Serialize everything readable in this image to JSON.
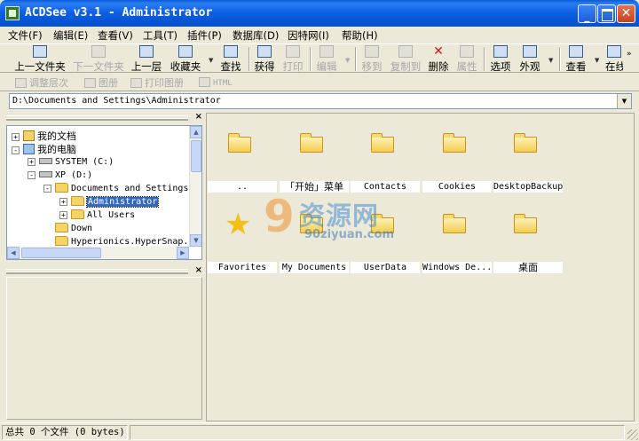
{
  "window": {
    "title": "ACDSee v3.1 - Administrator"
  },
  "menu": [
    "文件(F)",
    "编辑(E)",
    "查看(V)",
    "工具(T)",
    "插件(P)",
    "数据库(D)",
    "因特网(I)",
    "帮助(H)"
  ],
  "toolbar": {
    "items": [
      {
        "label": "上一文件夹",
        "icon": "folder-back-icon",
        "enabled": true,
        "dropdown": false
      },
      {
        "label": "下一文件夹",
        "icon": "folder-forward-icon",
        "enabled": false,
        "dropdown": false
      },
      {
        "label": "上一层",
        "icon": "folder-up-icon",
        "enabled": true,
        "dropdown": false
      },
      {
        "label": "收藏夹",
        "icon": "favorites-icon",
        "enabled": true,
        "dropdown": true
      },
      {
        "label": "查找",
        "icon": "binoculars-icon",
        "enabled": true,
        "dropdown": false
      },
      {
        "label": "获得",
        "icon": "acquire-icon",
        "enabled": true,
        "dropdown": false
      },
      {
        "label": "打印",
        "icon": "printer-icon",
        "enabled": false,
        "dropdown": false
      },
      {
        "label": "编辑",
        "icon": "edit-image-icon",
        "enabled": false,
        "dropdown": true
      },
      {
        "label": "移到",
        "icon": "move-to-icon",
        "enabled": false,
        "dropdown": false
      },
      {
        "label": "复制到",
        "icon": "copy-to-icon",
        "enabled": false,
        "dropdown": false
      },
      {
        "label": "删除",
        "icon": "delete-x-icon",
        "enabled": true,
        "dropdown": false
      },
      {
        "label": "属性",
        "icon": "properties-icon",
        "enabled": false,
        "dropdown": false
      },
      {
        "label": "选项",
        "icon": "options-tools-icon",
        "enabled": true,
        "dropdown": false
      },
      {
        "label": "外观",
        "icon": "layout-icon",
        "enabled": true,
        "dropdown": true
      },
      {
        "label": "查看",
        "icon": "view-list-icon",
        "enabled": true,
        "dropdown": true
      },
      {
        "label": "在线",
        "icon": "online-icon",
        "enabled": true,
        "dropdown": false
      }
    ]
  },
  "toolbar2": {
    "items": [
      {
        "label": "调整层次",
        "icon": "adjust-levels-icon"
      },
      {
        "label": "图册",
        "icon": "album-icon"
      },
      {
        "label": "打印图册",
        "icon": "print-album-icon"
      },
      {
        "label": "HTML",
        "icon": "html-icon"
      }
    ]
  },
  "address": {
    "path": "D:\\Documents and Settings\\Administrator"
  },
  "tree": {
    "nodes": [
      {
        "label": "我的文档",
        "icon": "my-documents-icon",
        "expander": "+",
        "mono": false,
        "selected": false
      },
      {
        "label": "我的电脑",
        "icon": "my-computer-icon",
        "expander": "-",
        "mono": false,
        "selected": false
      },
      {
        "label": "SYSTEM (C:)",
        "icon": "drive-icon",
        "expander": "+",
        "mono": true,
        "selected": false
      },
      {
        "label": "XP (D:)",
        "icon": "drive-icon",
        "expander": "-",
        "mono": true,
        "selected": false
      },
      {
        "label": "Documents and Settings",
        "icon": "folder-open-icon",
        "expander": "-",
        "mono": true,
        "selected": false
      },
      {
        "label": "Administrator",
        "icon": "folder-open-icon",
        "expander": "+",
        "mono": true,
        "selected": true
      },
      {
        "label": "All Users",
        "icon": "folder-icon",
        "expander": "+",
        "mono": true,
        "selected": false
      },
      {
        "label": "Down",
        "icon": "folder-icon",
        "expander": "",
        "mono": true,
        "selected": false
      },
      {
        "label": "Hyperionics.HyperSnap.I",
        "icon": "folder-icon",
        "expander": "",
        "mono": true,
        "selected": false
      }
    ]
  },
  "files": [
    {
      "label": "..",
      "icon": "folder-up-icon",
      "cjk": false
    },
    {
      "label": "「开始」菜单",
      "icon": "folder-icon",
      "cjk": true
    },
    {
      "label": "Contacts",
      "icon": "folder-icon",
      "cjk": false
    },
    {
      "label": "Cookies",
      "icon": "folder-icon",
      "cjk": false
    },
    {
      "label": "DesktopBackup",
      "icon": "folder-icon",
      "cjk": false
    },
    {
      "label": "Favorites",
      "icon": "star-folder-icon",
      "cjk": false
    },
    {
      "label": "My Documents",
      "icon": "folder-icon",
      "cjk": false
    },
    {
      "label": "UserData",
      "icon": "folder-icon",
      "cjk": false
    },
    {
      "label": "Windows De...",
      "icon": "folder-icon",
      "cjk": false
    },
    {
      "label": "桌面",
      "icon": "folder-icon",
      "cjk": true
    }
  ],
  "watermark": {
    "mark": "9",
    "name": "资源网",
    "url": "90ziyuan.com",
    "color": "#f08a24"
  },
  "status": {
    "text": "总共 0 个文件 (0 bytes)"
  }
}
